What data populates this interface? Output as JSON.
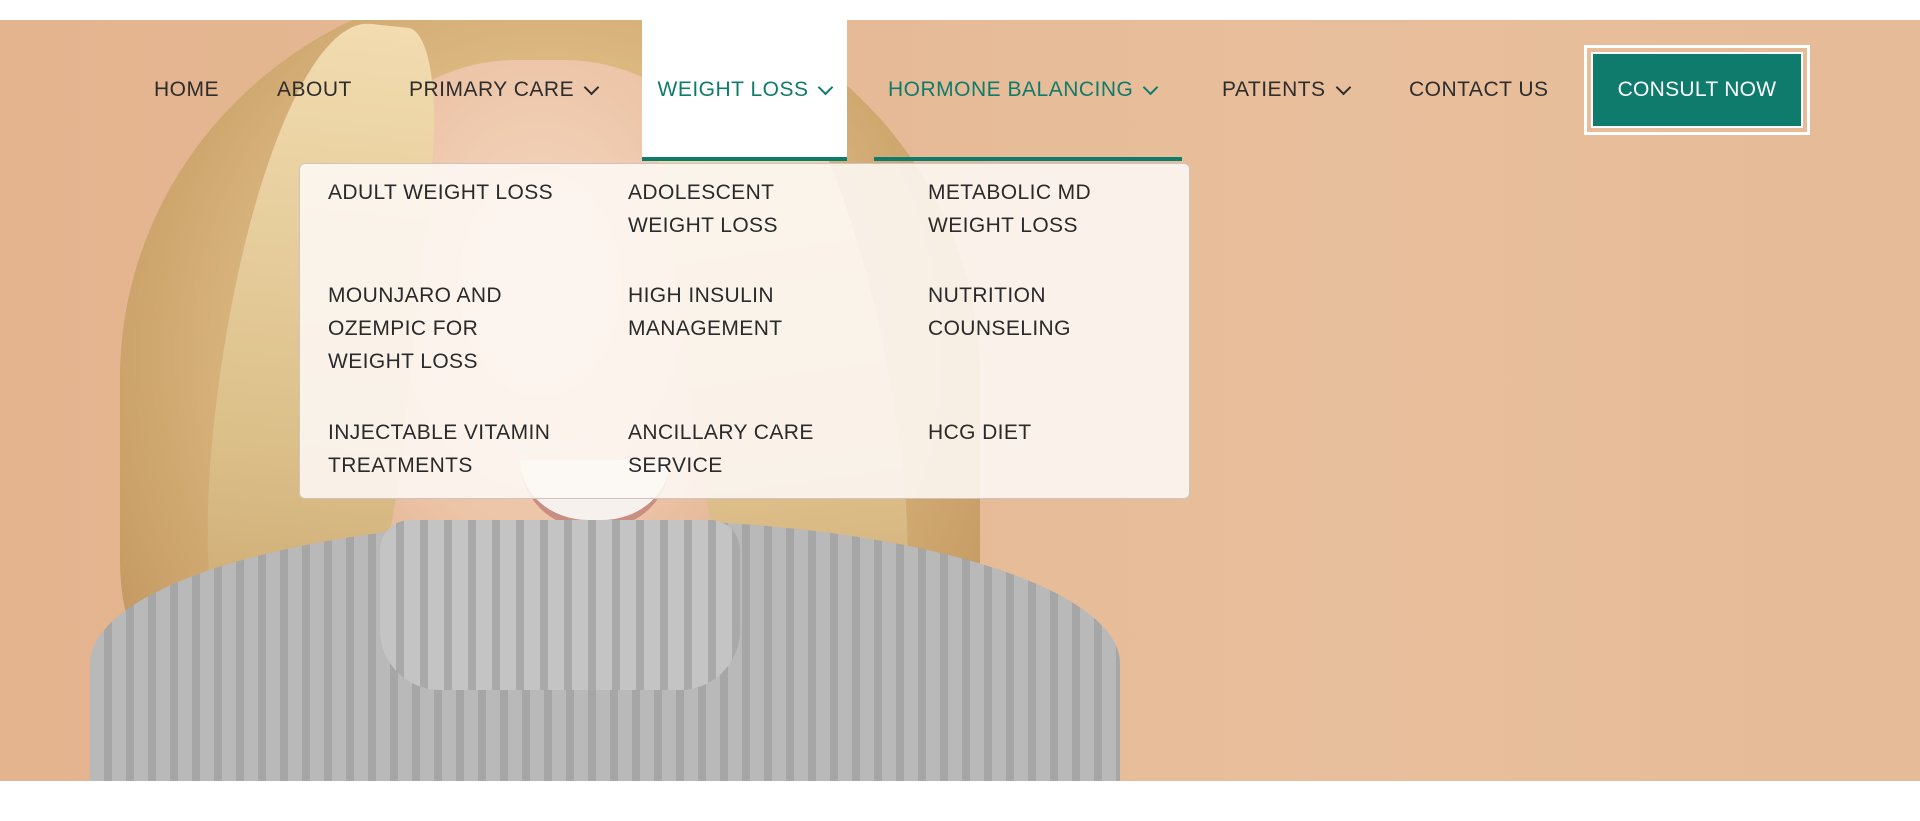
{
  "nav": {
    "items": [
      {
        "label": "HOME"
      },
      {
        "label": "ABOUT"
      },
      {
        "label": "PRIMARY CARE"
      },
      {
        "label": "WEIGHT LOSS"
      },
      {
        "label": "HORMONE BALANCING"
      },
      {
        "label": "PATIENTS"
      },
      {
        "label": "CONTACT US"
      }
    ],
    "cta_label": "CONSULT NOW"
  },
  "dropdown": {
    "items": [
      {
        "label": "ADULT WEIGHT LOSS"
      },
      {
        "label": "ADOLESCENT\nWEIGHT LOSS"
      },
      {
        "label": "METABOLIC MD\nWEIGHT LOSS"
      },
      {
        "label": "MOUNJARO AND\nOZEMPIC FOR\nWEIGHT LOSS"
      },
      {
        "label": "HIGH INSULIN\nMANAGEMENT"
      },
      {
        "label": "NUTRITION\nCOUNSELING"
      },
      {
        "label": "INJECTABLE VITAMIN\nTREATMENTS"
      },
      {
        "label": "ANCILLARY CARE\nSERVICE"
      },
      {
        "label": "HCG DIET"
      }
    ]
  },
  "colors": {
    "accent": "#0e7b6c",
    "hero_background": "#e5b994",
    "text": "#2d2d2d"
  },
  "icons": {
    "dropdown_indicator": "chevron-down-icon"
  }
}
